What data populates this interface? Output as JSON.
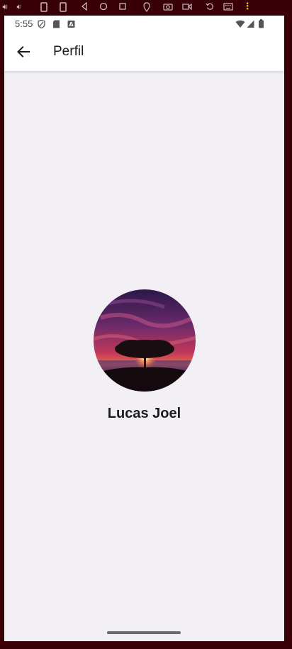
{
  "emulator_toolbar": {
    "icons": [
      "volume-up-icon",
      "volume-down-icon",
      "rotate-left-icon",
      "rotate-right-icon",
      "back-icon",
      "home-icon",
      "overview-icon",
      "location-icon",
      "camera-icon",
      "video-icon",
      "replay-icon",
      "keyboard-icon",
      "more-options-icon"
    ]
  },
  "status_bar": {
    "time": "5:55",
    "icons": [
      "shield-icon",
      "sd-card-icon",
      "font-icon",
      "wifi-icon",
      "signal-icon",
      "battery-icon"
    ]
  },
  "app_bar": {
    "title": "Perfil",
    "back_icon": "arrow-back-icon"
  },
  "profile": {
    "name": "Lucas Joel",
    "avatar_description": "sunset-tree-photo"
  },
  "colors": {
    "frame": "#3a0008",
    "background": "#f2f0f5",
    "app_bar": "#ffffff",
    "text": "#1c1b1f",
    "home_indicator": "#6a6a6a"
  }
}
